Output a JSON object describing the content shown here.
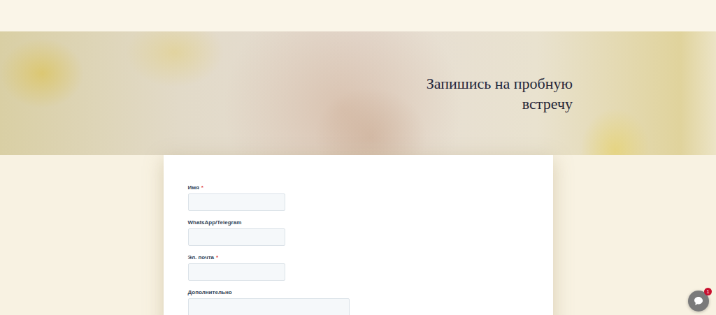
{
  "hero": {
    "title": "Запишись на пробную встречу"
  },
  "form": {
    "required_mark": "*",
    "fields": [
      {
        "label": "Имя",
        "required": true,
        "kind": "input"
      },
      {
        "label": "WhatsApp/Telegram",
        "required": false,
        "kind": "input"
      },
      {
        "label": "Эл. почта",
        "required": true,
        "kind": "input"
      },
      {
        "label": "Дополнительно",
        "required": false,
        "kind": "textarea"
      }
    ]
  },
  "chat": {
    "badge": "1"
  }
}
